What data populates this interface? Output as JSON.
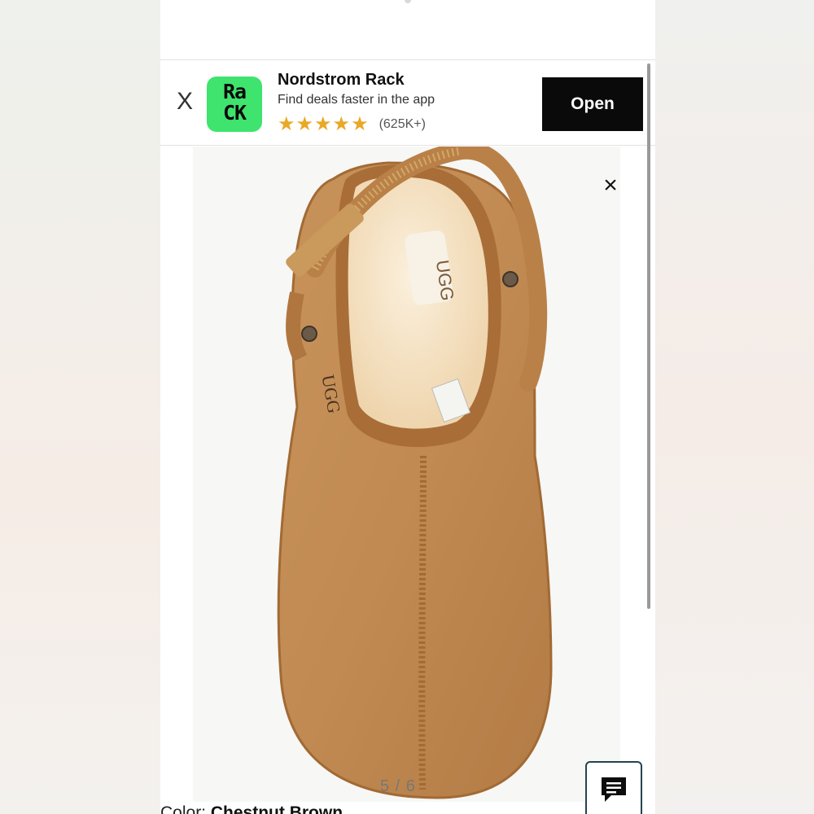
{
  "banner": {
    "close_label": "X",
    "app_icon_text": "Ra CK",
    "app_name": "Nordstrom Rack",
    "tagline": "Find deals faster in the app",
    "stars": "★★★★★",
    "rating_count": "(625K+)",
    "open_label": "Open"
  },
  "gallery": {
    "close_label": "×",
    "counter": "5 / 6",
    "image_subject": "UGG chestnut suede slipper with back strap, top view"
  },
  "product": {
    "color_label": "Color:",
    "color_value": "Chestnut Brown"
  },
  "colors": {
    "app_icon_bg": "#3ee46d",
    "open_button_bg": "#0a0a0a",
    "star_color": "#e9a826",
    "suede": "#c08a52",
    "shearling": "#f4e3c6",
    "chat_border": "#23434f"
  },
  "icons": {
    "banner_close": "close-icon",
    "gallery_close": "close-icon",
    "chat": "chat-icon"
  }
}
